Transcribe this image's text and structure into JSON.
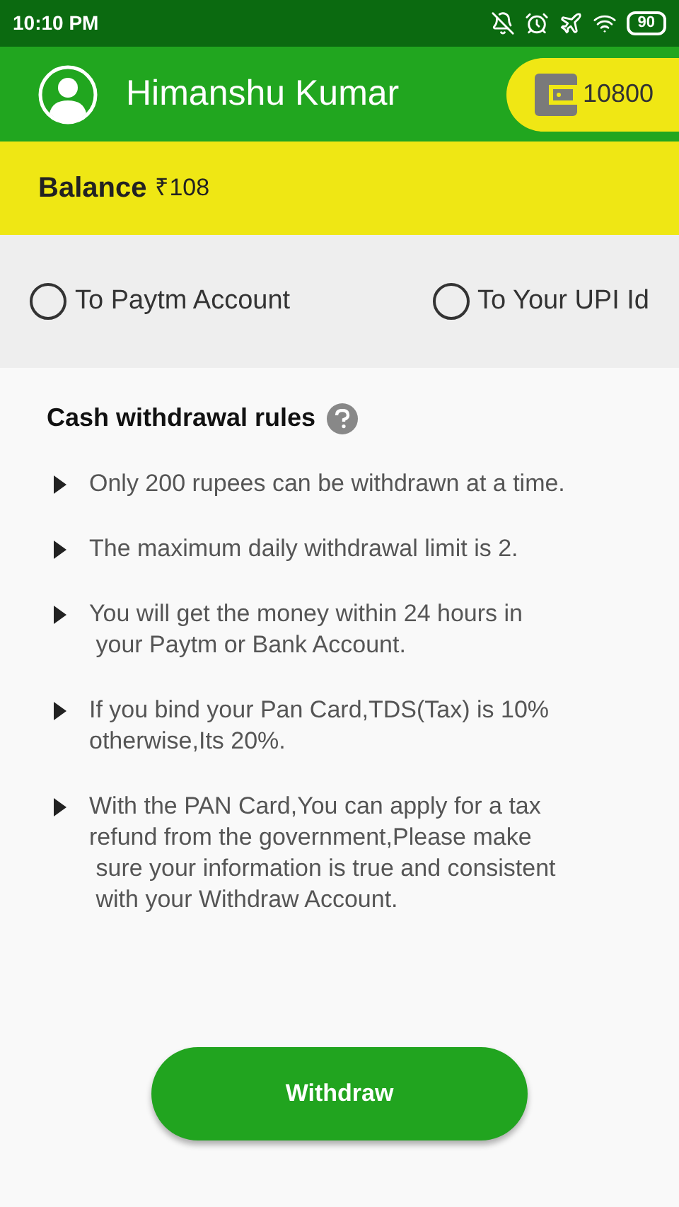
{
  "status_bar": {
    "time": "10:10 PM",
    "battery": "90"
  },
  "header": {
    "name": "Himanshu Kumar",
    "coins": "10800"
  },
  "balance": {
    "label": "Balance",
    "amount": "₹108"
  },
  "options": [
    {
      "label": "To Paytm Account",
      "selected": false
    },
    {
      "label": "To Your UPI Id",
      "selected": false
    }
  ],
  "rules": {
    "title": "Cash withdrawal rules",
    "items": [
      "Only 200 rupees can be withdrawn at a time.",
      "The maximum daily withdrawal limit is 2.",
      "You will get the money within 24 hours in\n your Paytm or Bank Account.",
      "If you bind your Pan Card,TDS(Tax) is 10%\notherwise,Its 20%.",
      "With the PAN Card,You can apply for a tax\nrefund from the government,Please make\n sure your information is true and consistent\n with your Withdraw Account."
    ]
  },
  "button": "Withdraw"
}
